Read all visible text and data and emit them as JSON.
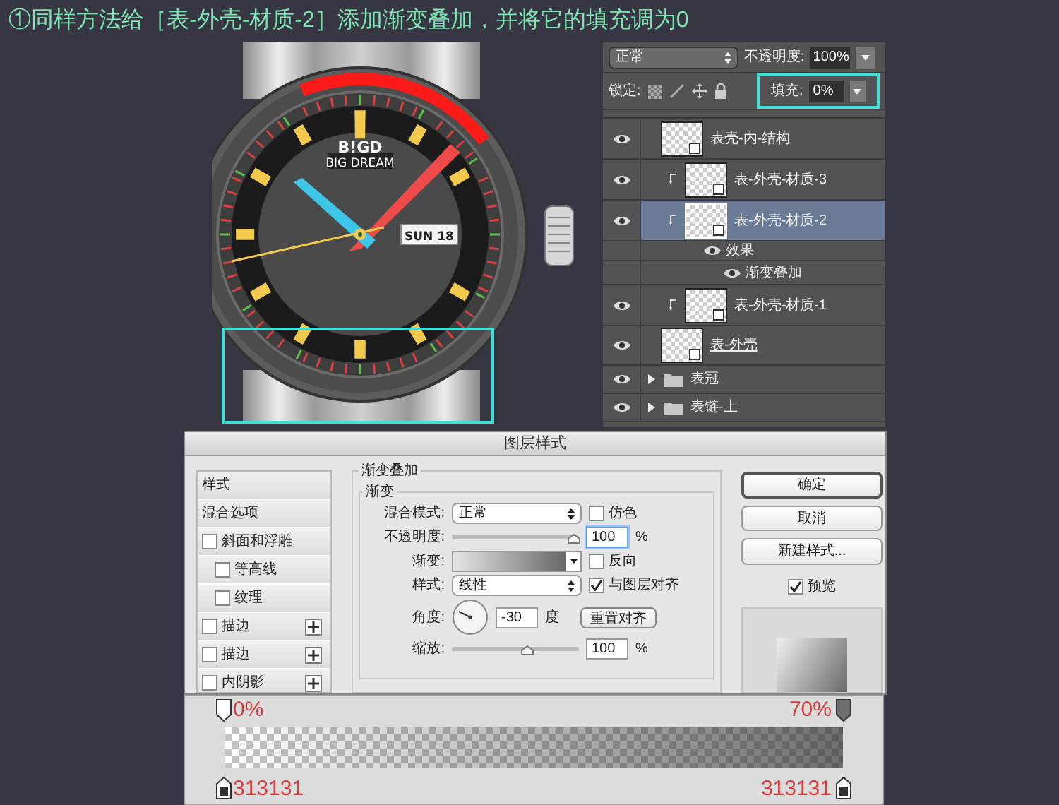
{
  "instruction": "①同样方法给［表-外壳-材质-2］添加渐变叠加，并将它的填充调为0",
  "watch": {
    "brand": "B!GD",
    "brand_subtitle": "BIG DREAM",
    "date_window": "SUN 18"
  },
  "layers_panel": {
    "blend_mode": "正常",
    "opacity_label": "不透明度:",
    "opacity": "100%",
    "lock_label": "锁定:",
    "fill_label": "填充:",
    "fill": "0%",
    "layers": [
      {
        "kind": "layer",
        "name": "表壳-内-结构",
        "clipped": false,
        "selected": false
      },
      {
        "kind": "layer",
        "name": "表-外壳-材质-3",
        "clipped": true,
        "selected": false
      },
      {
        "kind": "layer",
        "name": "表-外壳-材质-2",
        "clipped": true,
        "selected": true
      },
      {
        "kind": "effects",
        "name": "效果",
        "selected": false
      },
      {
        "kind": "effect",
        "name": "渐变叠加",
        "selected": false
      },
      {
        "kind": "layer",
        "name": "表-外壳-材质-1",
        "clipped": true,
        "selected": false
      },
      {
        "kind": "base",
        "name": "表-外壳",
        "clipped": false,
        "selected": false
      },
      {
        "kind": "group",
        "name": "表冠",
        "expanded": false,
        "selected": false
      },
      {
        "kind": "group",
        "name": "表链-上",
        "expanded": false,
        "selected": false
      }
    ]
  },
  "dialog": {
    "title": "图层样式",
    "style_list": [
      {
        "kind": "header",
        "label": "样式"
      },
      {
        "kind": "header",
        "label": "混合选项"
      },
      {
        "kind": "option",
        "label": "斜面和浮雕",
        "checked": false
      },
      {
        "kind": "sub-option",
        "label": "等高线",
        "checked": false
      },
      {
        "kind": "sub-option",
        "label": "纹理",
        "checked": false
      },
      {
        "kind": "option",
        "label": "描边",
        "checked": false,
        "addable": true
      },
      {
        "kind": "option",
        "label": "描边",
        "checked": false,
        "addable": true
      },
      {
        "kind": "option",
        "label": "内阴影",
        "checked": false,
        "addable": true
      }
    ],
    "gradient_overlay": {
      "section_title": "渐变叠加",
      "group_title": "渐变",
      "blend_mode_label": "混合模式:",
      "blend_mode": "正常",
      "dither_label": "仿色",
      "dither": false,
      "opacity_label": "不透明度:",
      "opacity_slider": {
        "level": 1
      },
      "opacity": "100",
      "opacity_unit": "%",
      "gradient_label": "渐变:",
      "reverse_label": "反向",
      "reverse": false,
      "style_label": "样式:",
      "style": "线性",
      "align_label": "与图层对齐",
      "align_with_layer": true,
      "angle_label": "角度:",
      "angle": "-30",
      "angle_unit": "度",
      "reset_button": "重置对齐",
      "scale_label": "缩放:",
      "scale_slider": {
        "level": 0.6
      },
      "scale": "100",
      "scale_unit": "%"
    },
    "buttons": [
      {
        "label": "确定",
        "default": true
      },
      {
        "label": "取消",
        "default": false
      },
      {
        "label": "新建样式...",
        "default": false
      }
    ],
    "preview_label": "预览",
    "preview": true
  },
  "gradient_editor": {
    "opacity_stops": [
      {
        "label": "0%",
        "color": "#ffffff"
      },
      {
        "label": "70%",
        "color": "#6e6e6e"
      }
    ],
    "color_stops": [
      {
        "label": "313131",
        "color": "#313131"
      },
      {
        "label": "313131",
        "color": "#313131"
      }
    ]
  }
}
